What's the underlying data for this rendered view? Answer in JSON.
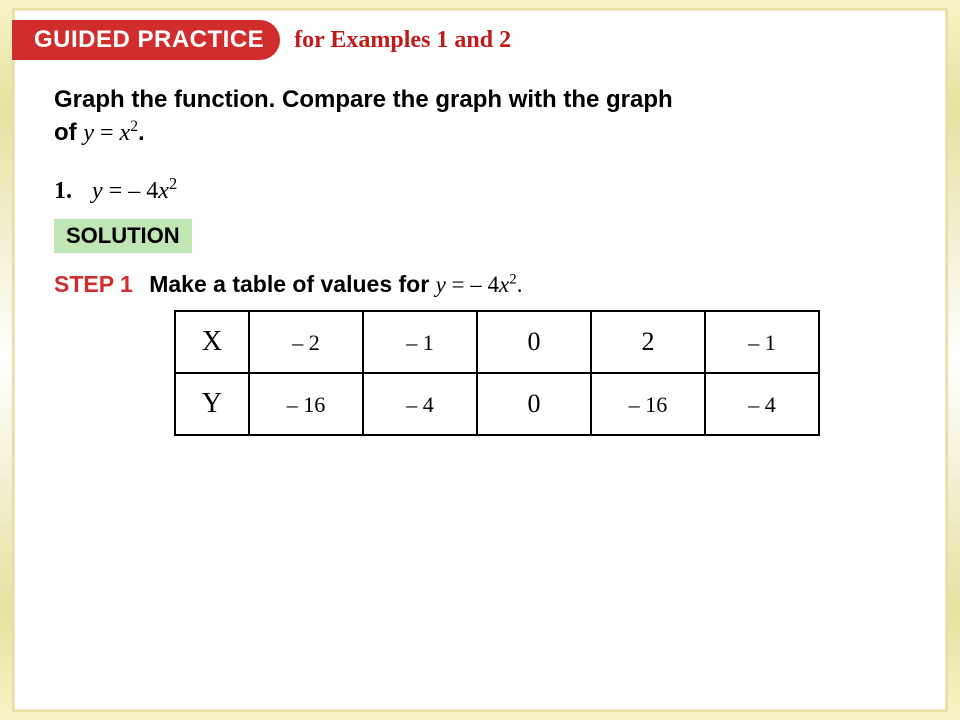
{
  "header": {
    "pill": "GUIDED PRACTICE",
    "subtitle": "for Examples 1 and 2"
  },
  "prompt": {
    "line1": "Graph the function. Compare the graph with the graph",
    "line2_prefix": "of ",
    "line2_eq_y": "y",
    "line2_eq_mid": " = ",
    "line2_eq_x": "x",
    "line2_eq_sup": "2",
    "line2_period": "."
  },
  "problem": {
    "number": "1.",
    "eq_y": "y",
    "eq_mid": " = ",
    "eq_neg": "– 4",
    "eq_x": "x",
    "eq_sup": "2"
  },
  "solution_label": "SOLUTION",
  "step1": {
    "label": "STEP 1",
    "text_prefix": "Make a table of values for ",
    "eq_y": "y",
    "eq_mid": " = ",
    "eq_neg": "– 4",
    "eq_x": "x",
    "eq_sup": "2",
    "period": "."
  },
  "table": {
    "row1": {
      "head": "X",
      "c1": "– 2",
      "c2": "– 1",
      "c3": "0",
      "c4": "2",
      "c5": "– 1"
    },
    "row2": {
      "head": "Y",
      "c1": "– 16",
      "c2": "– 4",
      "c3": "0",
      "c4": "– 16",
      "c5": "– 4"
    }
  }
}
